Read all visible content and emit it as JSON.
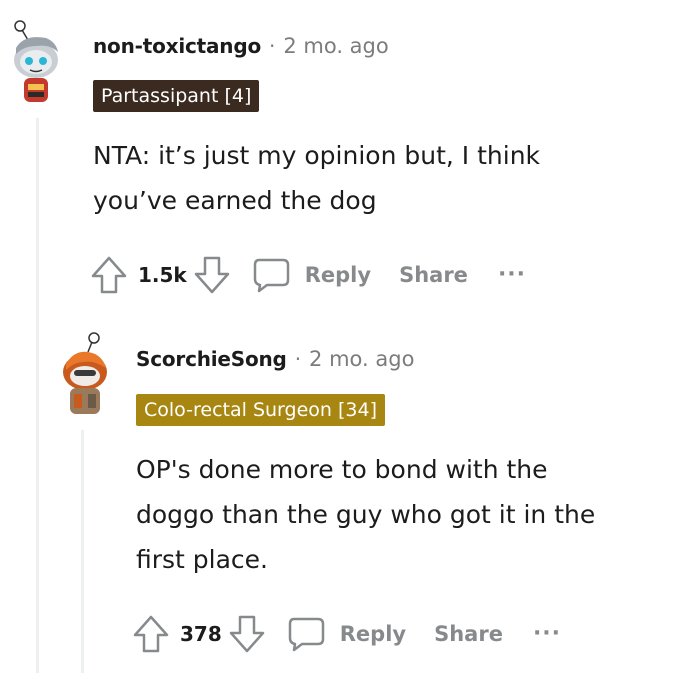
{
  "comments": [
    {
      "username": "non-toxictango",
      "separator": "·",
      "time": "2 mo. ago",
      "flair": "Partassipant [4]",
      "flair_color": "#3a2a20",
      "body_lines": [
        "NTA: it’s just my opinion but, I think",
        "you’ve earned the dog"
      ],
      "score": "1.5k",
      "reply_label": "Reply",
      "share_label": "Share",
      "more_label": "···",
      "avatar_icon": "snoo-avatar-icon"
    },
    {
      "username": "ScorchieSong",
      "separator": "·",
      "time": "2 mo. ago",
      "flair": "Colo-rectal Surgeon [34]",
      "flair_color": "#a78711",
      "body_lines": [
        "OP's done more to bond with the",
        "doggo than the guy who got it in the",
        "first place."
      ],
      "score": "378",
      "reply_label": "Reply",
      "share_label": "Share",
      "more_label": "···",
      "avatar_icon": "snoo-avatar-icon"
    }
  ]
}
